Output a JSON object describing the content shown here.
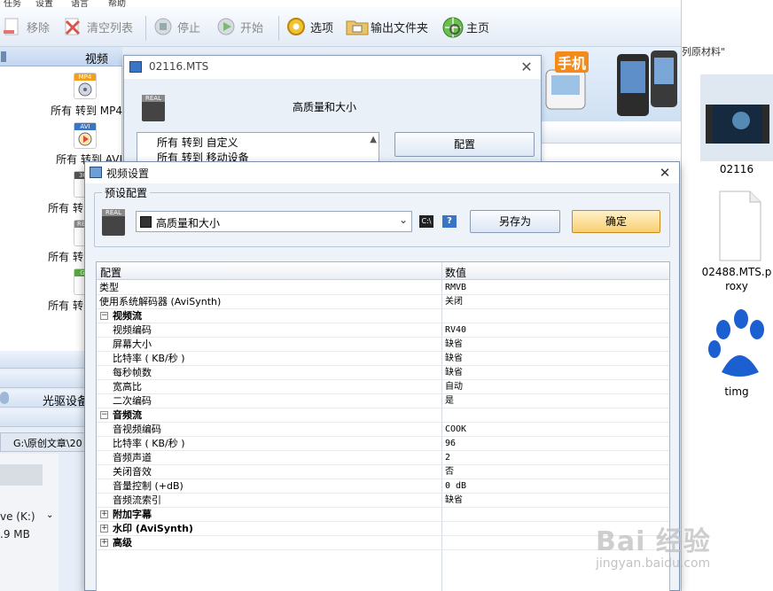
{
  "menubar": [
    "任务",
    "设置",
    "语言",
    "帮助"
  ],
  "toolbar": {
    "remove": "移除",
    "clear_list": "清空列表",
    "stop": "停止",
    "start": "开始",
    "options": "选项",
    "output_folder": "输出文件夹",
    "home": "主页"
  },
  "left_panel": {
    "header": "视频",
    "formats": [
      {
        "label": "所有 转到 MP4",
        "badge": "MP4"
      },
      {
        "label": "所有 转到 AVI",
        "badge": "AVI"
      },
      {
        "label": "所有 转",
        "badge": "3GP"
      },
      {
        "label": "所有 转",
        "badge": "REAL"
      },
      {
        "label": "所有 转",
        "badge": "GIF"
      }
    ],
    "categories": [
      "",
      "",
      "光驱设备",
      ""
    ],
    "path": "G:\\原创文章\\20",
    "drive_label": "ve (K:)",
    "drive_size": ".9 MB"
  },
  "banner": {
    "text": "手机"
  },
  "explorer": {
    "crumb": "列原材料\"",
    "files": [
      {
        "name": "02116"
      },
      {
        "name": "02488.MTS.proxy"
      },
      {
        "name": "timg"
      }
    ]
  },
  "mts_window": {
    "title": "02116.MTS",
    "preset": "高质量和大小",
    "list": [
      "所有 转到 自定义",
      "所有 转到 移动设备"
    ],
    "config_button": "配置"
  },
  "dialog": {
    "title": "视频设置",
    "preset_group": "预设配置",
    "preset_value": "高质量和大小",
    "save_as": "另存为",
    "ok": "确定",
    "grid_headers": {
      "name": "配置",
      "value": "数值"
    },
    "rows": [
      {
        "key": "类型",
        "value": "RMVB",
        "indent": 0,
        "cat": false
      },
      {
        "key": "使用系统解码器 (AviSynth)",
        "value": "关闭",
        "indent": 0,
        "cat": false
      },
      {
        "key": "视频流",
        "value": "",
        "indent": 0,
        "cat": true,
        "sign": "⊟"
      },
      {
        "key": "视频编码",
        "value": "RV40",
        "indent": 1,
        "cat": false
      },
      {
        "key": "屏幕大小",
        "value": "缺省",
        "indent": 1,
        "cat": false
      },
      {
        "key": "比特率 ( KB/秒 )",
        "value": "缺省",
        "indent": 1,
        "cat": false
      },
      {
        "key": "每秒帧数",
        "value": "缺省",
        "indent": 1,
        "cat": false
      },
      {
        "key": "宽高比",
        "value": "自动",
        "indent": 1,
        "cat": false
      },
      {
        "key": "二次编码",
        "value": "是",
        "indent": 1,
        "cat": false
      },
      {
        "key": "音频流",
        "value": "",
        "indent": 0,
        "cat": true,
        "sign": "⊟"
      },
      {
        "key": "音视频编码",
        "value": "COOK",
        "indent": 1,
        "cat": false
      },
      {
        "key": "比特率 ( KB/秒 )",
        "value": "96",
        "indent": 1,
        "cat": false
      },
      {
        "key": "音频声道",
        "value": "2",
        "indent": 1,
        "cat": false
      },
      {
        "key": "关闭音效",
        "value": "否",
        "indent": 1,
        "cat": false
      },
      {
        "key": "音量控制 (+dB)",
        "value": "0 dB",
        "indent": 1,
        "cat": false
      },
      {
        "key": "音频流索引",
        "value": "缺省",
        "indent": 1,
        "cat": false
      },
      {
        "key": "附加字幕",
        "value": "",
        "indent": 0,
        "cat": true,
        "sign": "⊞"
      },
      {
        "key": "水印 (AviSynth)",
        "value": "",
        "indent": 0,
        "cat": true,
        "sign": "⊞"
      },
      {
        "key": "高级",
        "value": "",
        "indent": 0,
        "cat": true,
        "sign": "⊞"
      }
    ]
  },
  "watermark": {
    "brand": "Bai 经验",
    "url": "jingyan.baidu.com"
  },
  "colors": {
    "accent": "#3a74c4",
    "ok_button": "#f9cf73",
    "paw": "#1b5fd1"
  }
}
